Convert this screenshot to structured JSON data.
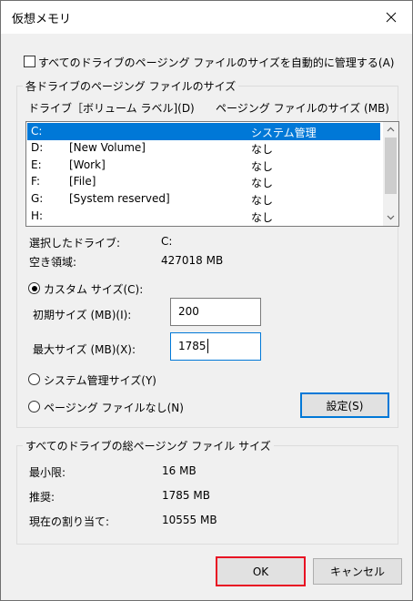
{
  "window": {
    "title": "仮想メモリ"
  },
  "auto_manage": {
    "label": "すべてのドライブのページング ファイルのサイズを自動的に管理する(A)",
    "checked": false
  },
  "per_drive_group": {
    "title": "各ドライブのページング ファイルのサイズ",
    "col_drive": "ドライブ［ボリューム ラベル](D)",
    "col_size": "ページング ファイルのサイズ (MB)",
    "rows": [
      {
        "drive": "C:",
        "label": "",
        "size": "システム管理",
        "selected": true
      },
      {
        "drive": "D:",
        "label": "[New Volume]",
        "size": "なし",
        "selected": false
      },
      {
        "drive": "E:",
        "label": "[Work]",
        "size": "なし",
        "selected": false
      },
      {
        "drive": "F:",
        "label": "[File]",
        "size": "なし",
        "selected": false
      },
      {
        "drive": "G:",
        "label": "[System reserved]",
        "size": "なし",
        "selected": false
      },
      {
        "drive": "H:",
        "label": "",
        "size": "なし",
        "selected": false
      }
    ],
    "selected_drive_label": "選択したドライブ:",
    "selected_drive_value": "C:",
    "free_space_label": "空き領域:",
    "free_space_value": "427018 MB",
    "custom_size_label": "カスタム サイズ(C):",
    "initial_size_label": "初期サイズ (MB)(I):",
    "initial_size_value": "200",
    "max_size_label": "最大サイズ (MB)(X):",
    "max_size_value": "1785",
    "system_managed_label": "システム管理サイズ(Y)",
    "no_paging_label": "ページング ファイルなし(N)",
    "set_button": "設定(S)",
    "size_option": "custom"
  },
  "total_group": {
    "title": "すべてのドライブの総ページング ファイル サイズ",
    "min_label": "最小限:",
    "min_value": "16 MB",
    "recommended_label": "推奨:",
    "recommended_value": "1785 MB",
    "current_label": "現在の割り当て:",
    "current_value": "10555 MB"
  },
  "footer": {
    "ok": "OK",
    "cancel": "キャンセル"
  },
  "colors": {
    "selection": "#0078d7",
    "ok_border": "#e81123",
    "dialog_bg": "#f0f0f0"
  }
}
